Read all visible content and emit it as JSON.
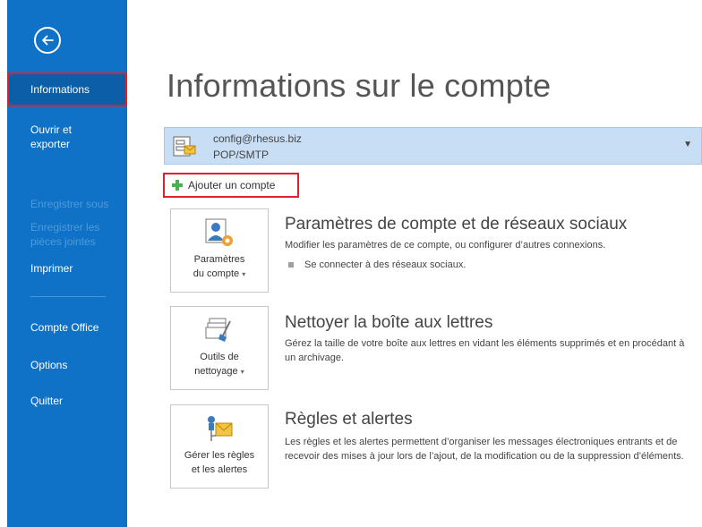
{
  "sidebar": {
    "back_label": "Retour",
    "items": [
      {
        "label": "Informations"
      },
      {
        "label": "Ouvrir et exporter"
      },
      {
        "label": "Enregistrer sous"
      },
      {
        "label": "Enregistrer les pièces jointes"
      },
      {
        "label": "Imprimer"
      },
      {
        "label": "Compte Office"
      },
      {
        "label": "Options"
      },
      {
        "label": "Quitter"
      }
    ]
  },
  "main": {
    "title": "Informations sur le compte",
    "account": {
      "email": "config@rhesus.biz",
      "type": "POP/SMTP"
    },
    "add_account_label": "Ajouter un compte",
    "sections": [
      {
        "tile_line1": "Paramètres",
        "tile_line2": "du compte",
        "title": "Paramètres de compte et de réseaux sociaux",
        "description": "Modifier les paramètres de ce compte, ou configurer d’autres connexions.",
        "bullet": "Se connecter à des réseaux sociaux."
      },
      {
        "tile_line1": "Outils de",
        "tile_line2": "nettoyage",
        "title": "Nettoyer la boîte aux lettres",
        "description": "Gérez la taille de votre boîte aux lettres en vidant les éléments supprimés et en procédant à un archivage."
      },
      {
        "tile_line1": "Gérer les règles",
        "tile_line2": "et les alertes",
        "title": "Règles et alertes",
        "description": "Les règles et les alertes permettent d’organiser les messages électroniques entrants et de recevoir des mises à jour lors de l’ajout, de la modification ou de la suppression d’éléments."
      }
    ]
  }
}
